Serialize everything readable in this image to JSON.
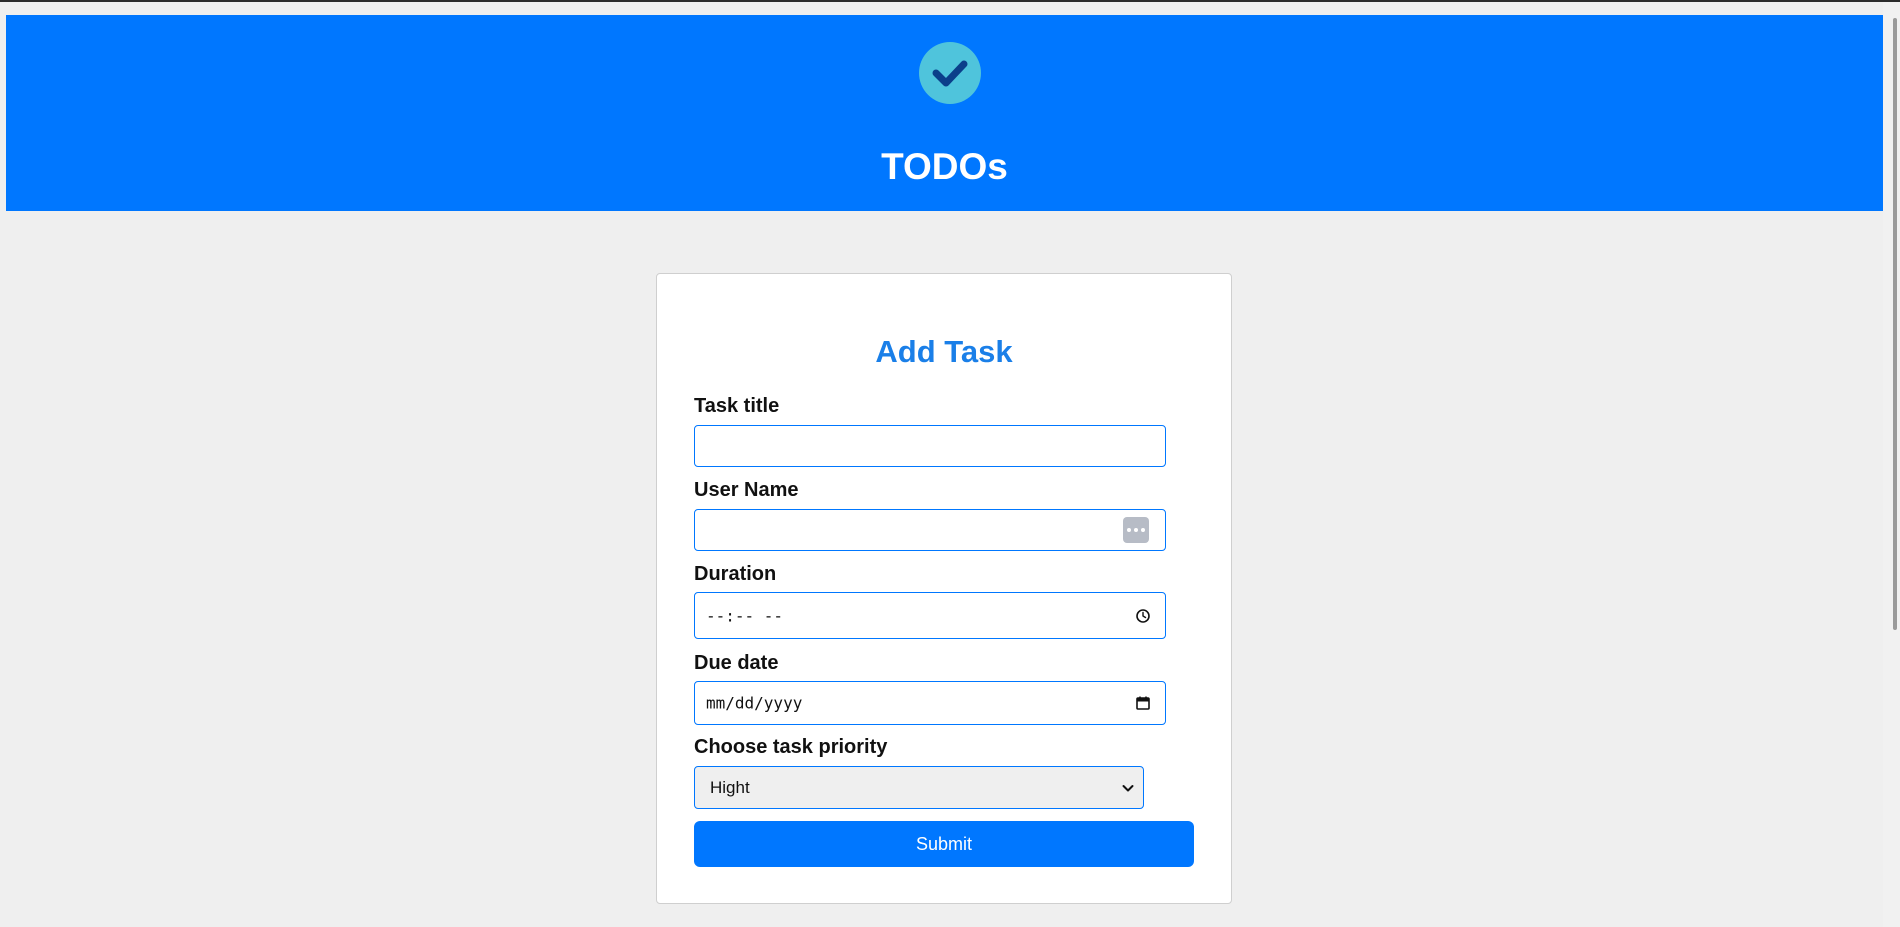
{
  "header": {
    "title": "TODOs",
    "logo_icon": "check-circle-icon",
    "background": "#0077ff"
  },
  "form": {
    "title": "Add Task",
    "task_title": {
      "label": "Task title",
      "value": ""
    },
    "user_name": {
      "label": "User Name",
      "value": "",
      "icon": "dots-icon"
    },
    "duration": {
      "label": "Duration",
      "placeholder": "--:-- --",
      "icon": "clock-icon"
    },
    "due_date": {
      "label": "Due date",
      "placeholder": "mm/dd/yyyy",
      "icon": "calendar-icon"
    },
    "priority": {
      "label": "Choose task priority",
      "selected": "Hight",
      "icon": "chevron-down-icon"
    },
    "submit_label": "Submit"
  },
  "colors": {
    "accent": "#0077ff",
    "title": "#1a7fe8",
    "logo": "#4fc4dc",
    "page_bg": "#efefef"
  }
}
